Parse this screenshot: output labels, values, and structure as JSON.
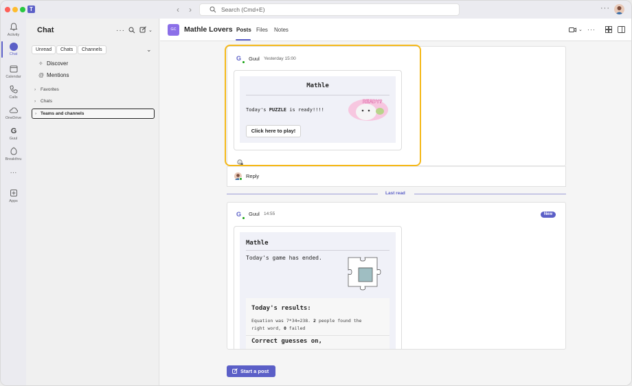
{
  "titlebar": {
    "search_placeholder": "Search (Cmd+E)",
    "more": "···"
  },
  "rail": {
    "items": [
      {
        "label": "Activity",
        "icon": "bell-icon"
      },
      {
        "label": "Chat",
        "icon": "chat-icon"
      },
      {
        "label": "Calendar",
        "icon": "calendar-icon"
      },
      {
        "label": "Calls",
        "icon": "phone-icon"
      },
      {
        "label": "OneDrive",
        "icon": "cloud-icon"
      },
      {
        "label": "Guul",
        "icon": "guul-app-icon"
      },
      {
        "label": "Breakthru",
        "icon": "breakthru-icon"
      },
      {
        "label": "···",
        "icon": "more-icon"
      },
      {
        "label": "Apps",
        "icon": "apps-icon"
      }
    ]
  },
  "chat_panel": {
    "title": "Chat",
    "filters": [
      "Unread",
      "Chats",
      "Channels"
    ],
    "discover": "Discover",
    "mentions": "Mentions",
    "favorites": "Favorites",
    "chats": "Chats",
    "teams_and_channels": "Teams and channels"
  },
  "channel": {
    "avatar": "GC",
    "title": "Mathle Lovers",
    "tabs": [
      "Posts",
      "Files",
      "Notes"
    ]
  },
  "post1": {
    "sender": "Guul",
    "time": "Yesterday 15:00",
    "card_title": "Mathle",
    "text_pre": "Today's ",
    "text_bold": "PUZZLE",
    "text_post": " is ready!!!!",
    "sticker": "READY?",
    "button": "Click here to play!",
    "reply": "Reply"
  },
  "last_read": "Last read",
  "post2": {
    "sender": "Guul",
    "time": "14:55",
    "badge": "New",
    "card_title": "Mathle",
    "ended": "Today's game has ended.",
    "results_title": "Today's results:",
    "eq_pre": "Equation was 7*34=238. ",
    "eq_found": "2",
    "eq_mid": " people found the",
    "eq_line2_pre": "right word, ",
    "eq_failed": "0",
    "eq_line2_post": " failed",
    "correct": "Correct guesses on,"
  },
  "compose": {
    "start_post": "Start a post"
  },
  "colors": {
    "accent": "#5b5fc7",
    "highlight": "#f5b817",
    "online": "#13a10e"
  }
}
